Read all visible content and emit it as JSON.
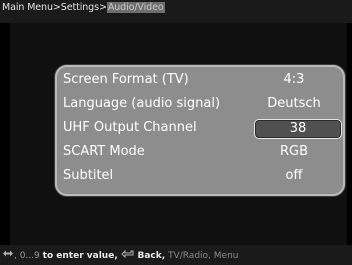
{
  "breadcrumb": {
    "items": [
      "Main Menu",
      "Settings",
      "Audio/Video"
    ],
    "separator": ">"
  },
  "settings": [
    {
      "label": "Screen Format (TV)",
      "value": "4:3",
      "selected": false
    },
    {
      "label": "Language (audio signal)",
      "value": "Deutsch",
      "selected": false
    },
    {
      "label": "UHF Output Channel",
      "value": "38",
      "selected": true
    },
    {
      "label": "SCART Mode",
      "value": "RGB",
      "selected": false
    },
    {
      "label": "Subtitel",
      "value": "off",
      "selected": false
    }
  ],
  "hint": {
    "arrows_text": ",",
    "digits_text": "0...9",
    "enter_text": "to enter value,",
    "back_text": "Back,",
    "tvradio_text": "TV/Radio,",
    "menu_text": "Menu"
  },
  "icons": {
    "arrows": "left-right-arrow-icon",
    "back": "back-arrow-icon"
  },
  "colors": {
    "panel": "#8d8d8d",
    "selection": "#505050",
    "text": "#ffffff"
  }
}
